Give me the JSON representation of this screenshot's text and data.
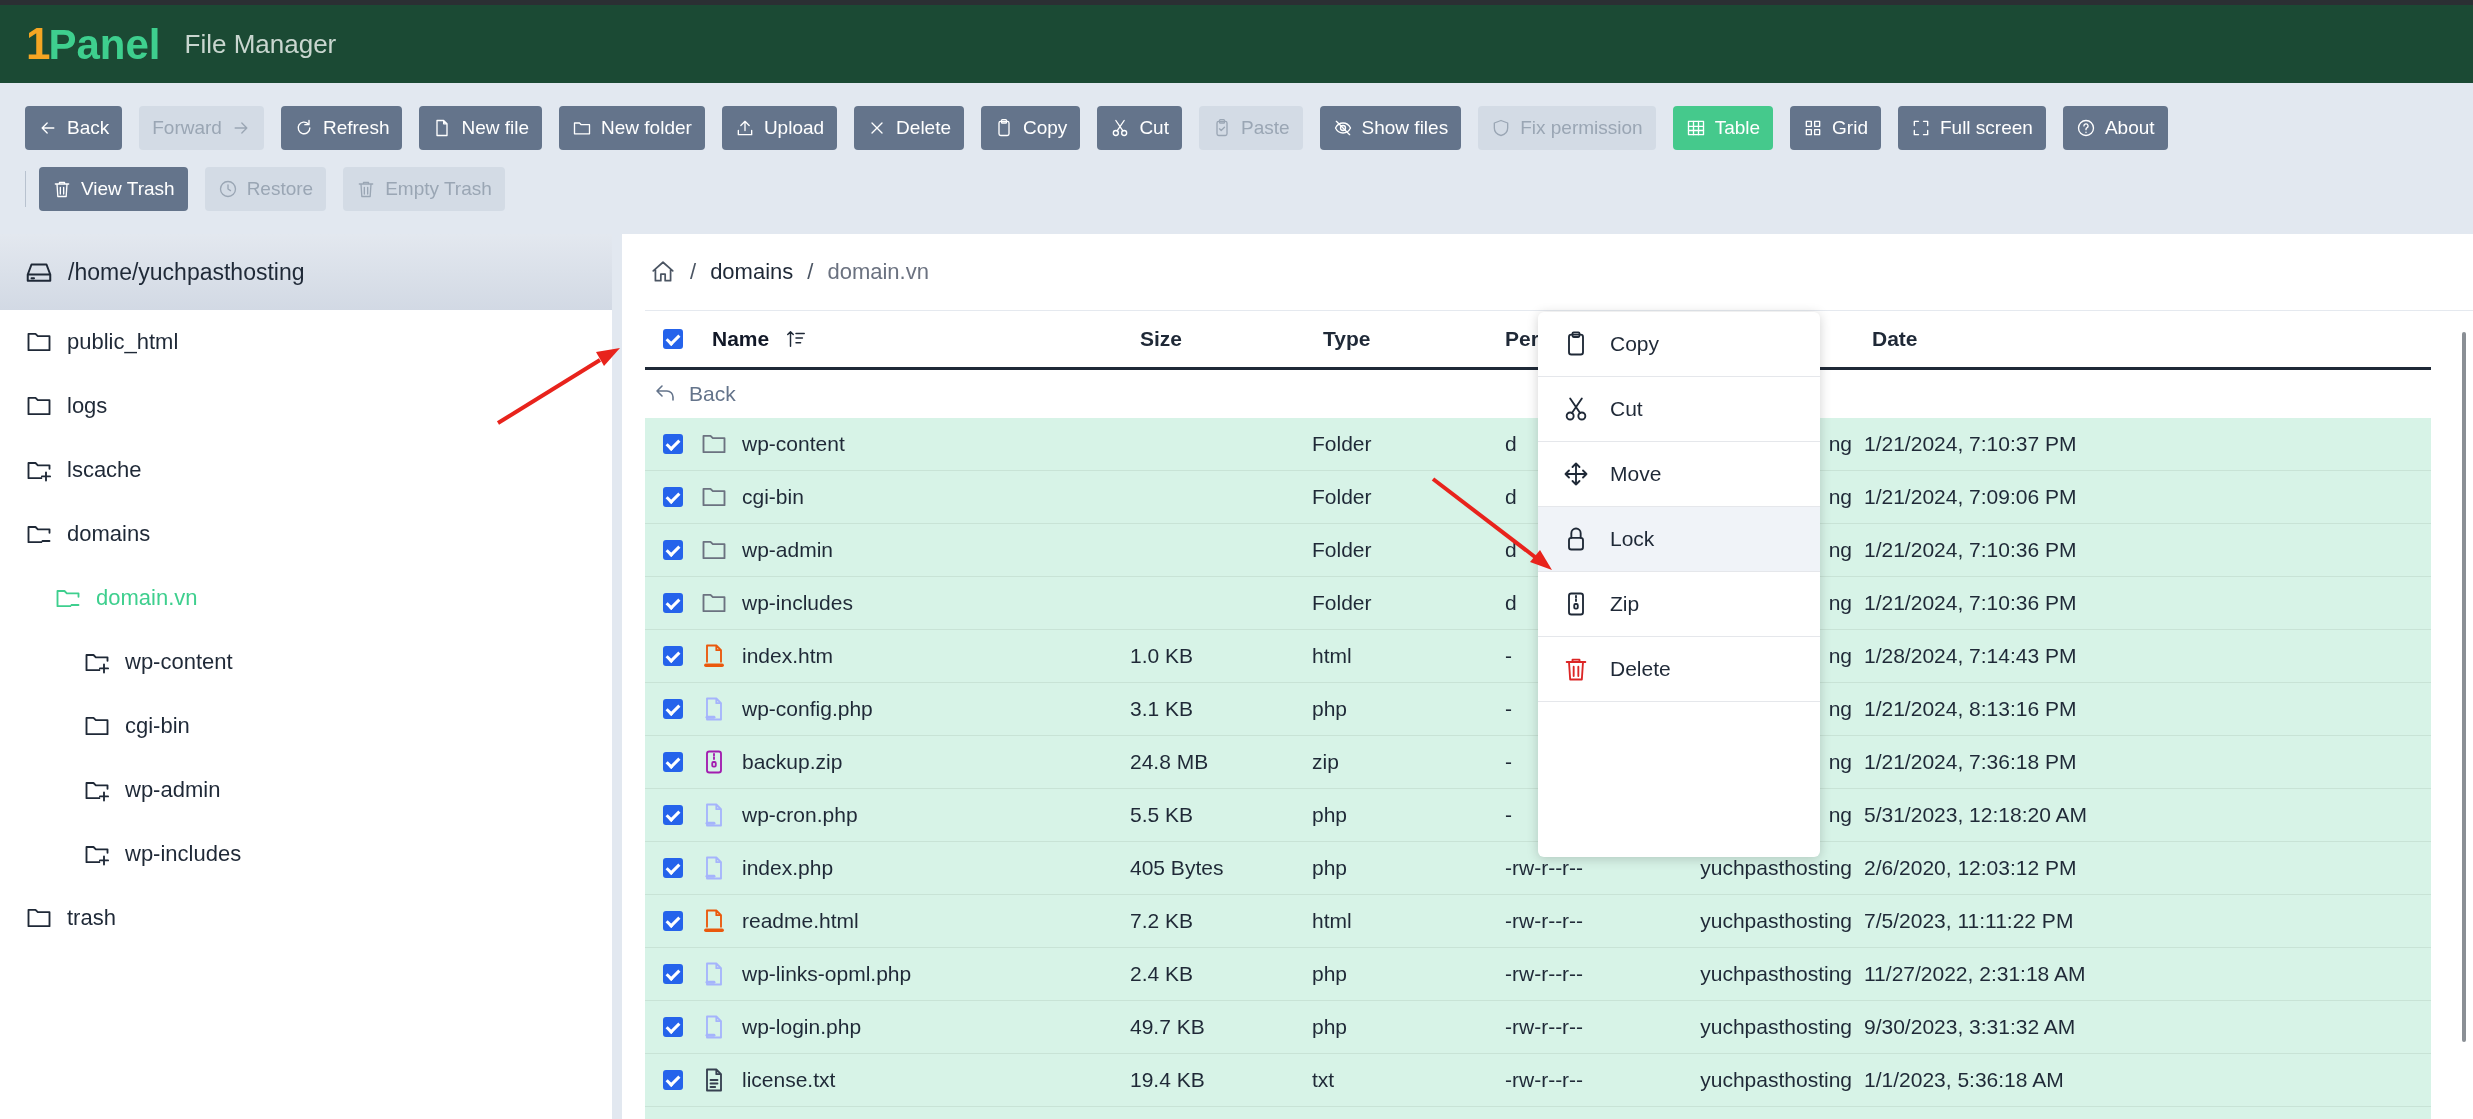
{
  "app": {
    "logo_mark": "1",
    "logo_text": "Panel",
    "title": "File Manager"
  },
  "toolbar": [
    [
      {
        "label": "Back",
        "kind": "back",
        "disabled": false,
        "selected": false
      },
      {
        "label": "Forward",
        "kind": "forward",
        "disabled": true,
        "selected": false
      },
      {
        "label": "Refresh",
        "kind": "refresh",
        "disabled": false,
        "selected": false
      },
      {
        "label": "New file",
        "kind": "newfile",
        "disabled": false,
        "selected": false
      },
      {
        "label": "New folder",
        "kind": "newfolder",
        "disabled": false,
        "selected": false
      },
      {
        "label": "Upload",
        "kind": "upload",
        "disabled": false,
        "selected": false
      },
      {
        "label": "Delete",
        "kind": "delete",
        "disabled": false,
        "selected": false
      },
      {
        "label": "Copy",
        "kind": "copy",
        "disabled": false,
        "selected": false
      },
      {
        "label": "Cut",
        "kind": "cut",
        "disabled": false,
        "selected": false
      },
      {
        "label": "Paste",
        "kind": "paste",
        "disabled": true,
        "selected": false
      },
      {
        "label": "Show files",
        "kind": "show",
        "disabled": false,
        "selected": false
      },
      {
        "label": "Fix permission",
        "kind": "permission",
        "disabled": true,
        "selected": false
      },
      {
        "label": "Table",
        "kind": "table",
        "disabled": false,
        "selected": true
      },
      {
        "label": "Grid",
        "kind": "grid",
        "disabled": false,
        "selected": false
      },
      {
        "label": "Full screen",
        "kind": "fullscreen",
        "disabled": false,
        "selected": false
      },
      {
        "label": "About",
        "kind": "about",
        "disabled": false,
        "selected": false
      }
    ],
    [
      {
        "label": "View Trash",
        "kind": "trash",
        "disabled": false,
        "selected": false
      },
      {
        "label": "Restore",
        "kind": "restore",
        "disabled": true,
        "selected": false
      },
      {
        "label": "Empty Trash",
        "kind": "trash",
        "disabled": true,
        "selected": false
      }
    ]
  ],
  "sidebar": {
    "root": "/home/yuchpasthosting",
    "items": [
      {
        "label": "public_html",
        "has_children": false,
        "expanded": false,
        "selected": false
      },
      {
        "label": "logs",
        "has_children": false,
        "expanded": false,
        "selected": false
      },
      {
        "label": "lscache",
        "has_children": true,
        "expanded": false,
        "selected": false
      },
      {
        "label": "domains",
        "has_children": true,
        "expanded": true,
        "selected": false,
        "children": [
          {
            "label": "domain.vn",
            "has_children": true,
            "expanded": true,
            "selected": true,
            "children": [
              {
                "label": "wp-content",
                "has_children": true,
                "expanded": false,
                "selected": false
              },
              {
                "label": "cgi-bin",
                "has_children": false,
                "expanded": false,
                "selected": false
              },
              {
                "label": "wp-admin",
                "has_children": true,
                "expanded": false,
                "selected": false
              },
              {
                "label": "wp-includes",
                "has_children": true,
                "expanded": false,
                "selected": false
              }
            ]
          }
        ]
      },
      {
        "label": "trash",
        "has_children": false,
        "expanded": false,
        "selected": false
      }
    ]
  },
  "breadcrumb": [
    {
      "separator": "/",
      "label": "domains",
      "current": false
    },
    {
      "separator": "/",
      "label": "domain.vn",
      "current": true
    }
  ],
  "table": {
    "all_checked": true,
    "back_label": "Back",
    "columns": [
      {
        "label": "Name",
        "sorted": true
      },
      {
        "label": "Size",
        "sorted": false
      },
      {
        "label": "Type",
        "sorted": false
      },
      {
        "label": "Per",
        "sorted": false
      },
      {
        "label": "Date",
        "sorted": false
      }
    ],
    "rows": [
      {
        "kind": "folder",
        "checked": true,
        "name": "wp-content",
        "type": "Folder",
        "permissions": "d",
        "owner": "ng",
        "date": "1/21/2024, 7:10:37 PM"
      },
      {
        "kind": "folder",
        "checked": true,
        "name": "cgi-bin",
        "type": "Folder",
        "permissions": "d",
        "owner": "ng",
        "date": "1/21/2024, 7:09:06 PM"
      },
      {
        "kind": "folder",
        "checked": true,
        "name": "wp-admin",
        "type": "Folder",
        "permissions": "d",
        "owner": "ng",
        "date": "1/21/2024, 7:10:36 PM"
      },
      {
        "kind": "folder",
        "checked": true,
        "name": "wp-includes",
        "type": "Folder",
        "permissions": "d",
        "owner": "ng",
        "date": "1/21/2024, 7:10:36 PM"
      },
      {
        "kind": "html",
        "checked": true,
        "name": "index.htm",
        "size": "1.0 KB",
        "type": "html",
        "permissions": "-",
        "owner": "ng",
        "date": "1/28/2024, 7:14:43 PM"
      },
      {
        "kind": "php",
        "checked": true,
        "name": "wp-config.php",
        "size": "3.1 KB",
        "type": "php",
        "permissions": "-",
        "owner": "ng",
        "date": "1/21/2024, 8:13:16 PM"
      },
      {
        "kind": "zip",
        "checked": true,
        "name": "backup.zip",
        "size": "24.8 MB",
        "type": "zip",
        "permissions": "-",
        "owner": "ng",
        "date": "1/21/2024, 7:36:18 PM"
      },
      {
        "kind": "php",
        "checked": true,
        "name": "wp-cron.php",
        "size": "5.5 KB",
        "type": "php",
        "permissions": "-",
        "owner": "ng",
        "date": "5/31/2023, 12:18:20 AM"
      },
      {
        "kind": "php",
        "checked": true,
        "name": "index.php",
        "size": "405 Bytes",
        "type": "php",
        "permissions": "-rw-r--r--",
        "owner": "yuchpasthosting",
        "date": "2/6/2020, 12:03:12 PM"
      },
      {
        "kind": "html",
        "checked": true,
        "name": "readme.html",
        "size": "7.2 KB",
        "type": "html",
        "permissions": "-rw-r--r--",
        "owner": "yuchpasthosting",
        "date": "7/5/2023, 11:11:22 PM"
      },
      {
        "kind": "php",
        "checked": true,
        "name": "wp-links-opml.php",
        "size": "2.4 KB",
        "type": "php",
        "permissions": "-rw-r--r--",
        "owner": "yuchpasthosting",
        "date": "11/27/2022, 2:31:18 AM"
      },
      {
        "kind": "php",
        "checked": true,
        "name": "wp-login.php",
        "size": "49.7 KB",
        "type": "php",
        "permissions": "-rw-r--r--",
        "owner": "yuchpasthosting",
        "date": "9/30/2023, 3:31:32 AM"
      },
      {
        "kind": "text",
        "checked": true,
        "name": "license.txt",
        "size": "19.4 KB",
        "type": "txt",
        "permissions": "-rw-r--r--",
        "owner": "yuchpasthosting",
        "date": "1/1/2023, 5:36:18 AM"
      }
    ]
  },
  "context_menu": [
    {
      "label": "Copy",
      "kind": "copy",
      "highlighted": false
    },
    {
      "label": "Cut",
      "kind": "cut",
      "highlighted": false
    },
    {
      "label": "Move",
      "kind": "move",
      "highlighted": false
    },
    {
      "label": "Lock",
      "kind": "lock",
      "highlighted": true
    },
    {
      "label": "Zip",
      "kind": "zip",
      "highlighted": false
    },
    {
      "label": "Delete",
      "kind": "danger",
      "highlighted": false
    }
  ]
}
